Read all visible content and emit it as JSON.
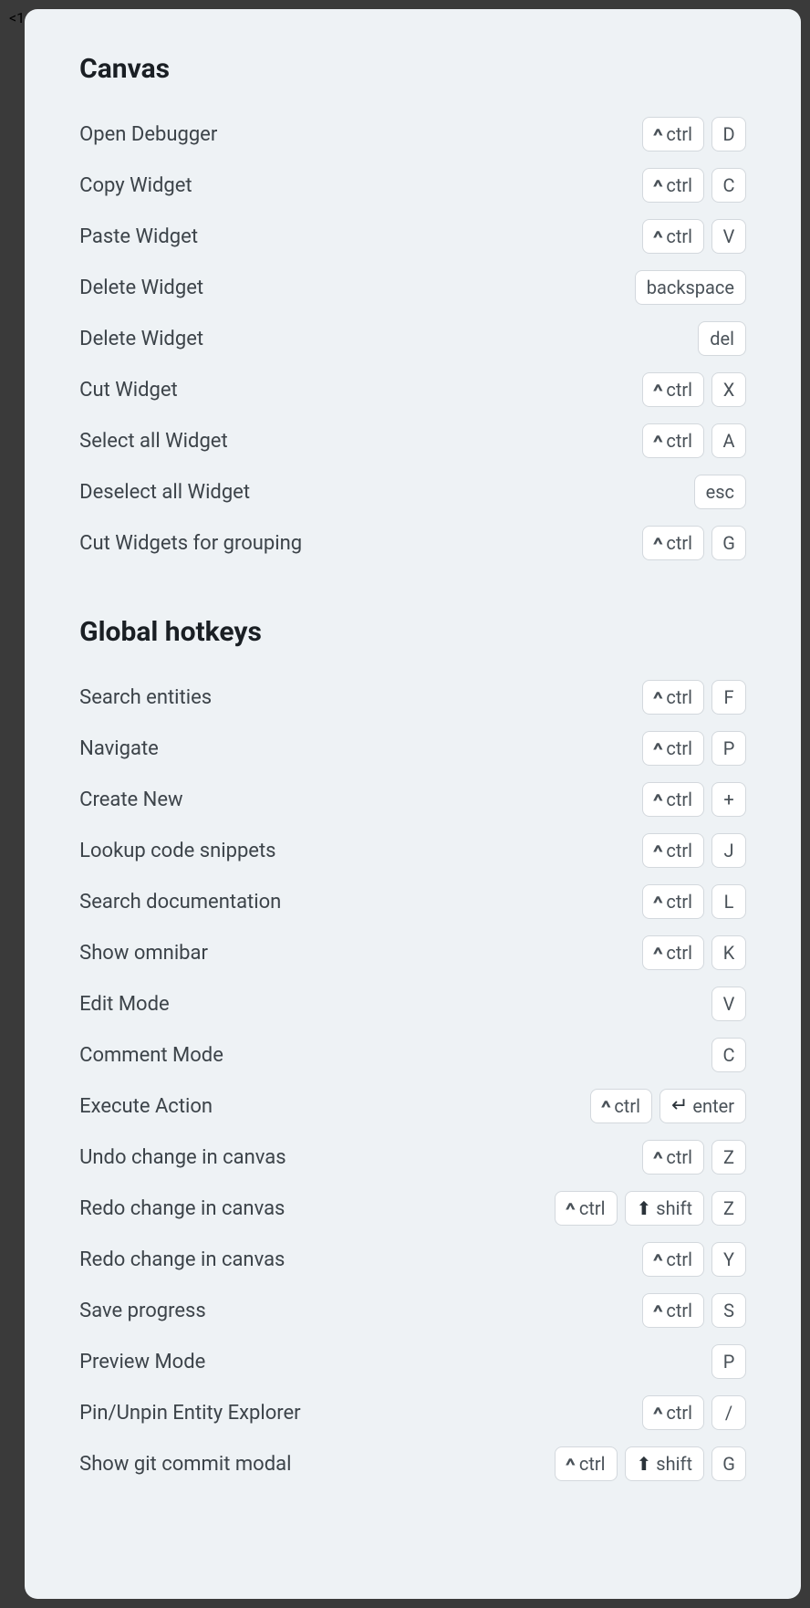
{
  "sections": [
    {
      "title": "Canvas",
      "rows": [
        {
          "label": "Open Debugger",
          "keys": [
            {
              "mod": "ctrl-chevron",
              "text": "ctrl"
            },
            {
              "text": "D"
            }
          ]
        },
        {
          "label": "Copy Widget",
          "keys": [
            {
              "mod": "ctrl-chevron",
              "text": "ctrl"
            },
            {
              "text": "C"
            }
          ]
        },
        {
          "label": "Paste Widget",
          "keys": [
            {
              "mod": "ctrl-chevron",
              "text": "ctrl"
            },
            {
              "text": "V"
            }
          ]
        },
        {
          "label": "Delete Widget",
          "keys": [
            {
              "text": "backspace"
            }
          ]
        },
        {
          "label": "Delete Widget",
          "keys": [
            {
              "text": "del"
            }
          ]
        },
        {
          "label": "Cut Widget",
          "keys": [
            {
              "mod": "ctrl-chevron",
              "text": "ctrl"
            },
            {
              "text": "X"
            }
          ]
        },
        {
          "label": "Select all Widget",
          "keys": [
            {
              "mod": "ctrl-chevron",
              "text": "ctrl"
            },
            {
              "text": "A"
            }
          ]
        },
        {
          "label": "Deselect all Widget",
          "keys": [
            {
              "text": "esc"
            }
          ]
        },
        {
          "label": "Cut Widgets for grouping",
          "keys": [
            {
              "mod": "ctrl-chevron",
              "text": "ctrl"
            },
            {
              "text": "G"
            }
          ]
        }
      ]
    },
    {
      "title": "Global hotkeys",
      "rows": [
        {
          "label": "Search entities",
          "keys": [
            {
              "mod": "ctrl-chevron",
              "text": "ctrl"
            },
            {
              "text": "F"
            }
          ]
        },
        {
          "label": "Navigate",
          "keys": [
            {
              "mod": "ctrl-chevron",
              "text": "ctrl"
            },
            {
              "text": "P"
            }
          ]
        },
        {
          "label": "Create New",
          "keys": [
            {
              "mod": "ctrl-chevron",
              "text": "ctrl"
            },
            {
              "text": "+"
            }
          ]
        },
        {
          "label": "Lookup code snippets",
          "keys": [
            {
              "mod": "ctrl-chevron",
              "text": "ctrl"
            },
            {
              "text": "J"
            }
          ]
        },
        {
          "label": "Search documentation",
          "keys": [
            {
              "mod": "ctrl-chevron",
              "text": "ctrl"
            },
            {
              "text": "L"
            }
          ]
        },
        {
          "label": "Show omnibar",
          "keys": [
            {
              "mod": "ctrl-chevron",
              "text": "ctrl"
            },
            {
              "text": "K"
            }
          ]
        },
        {
          "label": "Edit Mode",
          "keys": [
            {
              "text": "V"
            }
          ]
        },
        {
          "label": "Comment Mode",
          "keys": [
            {
              "text": "C"
            }
          ]
        },
        {
          "label": "Execute Action",
          "keys": [
            {
              "mod": "ctrl-chevron",
              "text": "ctrl"
            },
            {
              "mod": "enter",
              "text": "enter"
            }
          ]
        },
        {
          "label": "Undo change in canvas",
          "keys": [
            {
              "mod": "ctrl-chevron",
              "text": "ctrl"
            },
            {
              "text": "Z"
            }
          ]
        },
        {
          "label": "Redo change in canvas",
          "keys": [
            {
              "mod": "ctrl-chevron",
              "text": "ctrl"
            },
            {
              "mod": "shift",
              "text": "shift"
            },
            {
              "text": "Z"
            }
          ]
        },
        {
          "label": "Redo change in canvas",
          "keys": [
            {
              "mod": "ctrl-chevron",
              "text": "ctrl"
            },
            {
              "text": "Y"
            }
          ]
        },
        {
          "label": "Save progress",
          "keys": [
            {
              "mod": "ctrl-chevron",
              "text": "ctrl"
            },
            {
              "text": "S"
            }
          ]
        },
        {
          "label": "Preview Mode",
          "keys": [
            {
              "text": "P"
            }
          ]
        },
        {
          "label": "Pin/Unpin Entity Explorer",
          "keys": [
            {
              "mod": "ctrl-chevron",
              "text": "ctrl"
            },
            {
              "text": "/"
            }
          ]
        },
        {
          "label": "Show git commit modal",
          "keys": [
            {
              "mod": "ctrl-chevron",
              "text": "ctrl"
            },
            {
              "mod": "shift",
              "text": "shift"
            },
            {
              "text": "G"
            }
          ]
        }
      ]
    }
  ]
}
